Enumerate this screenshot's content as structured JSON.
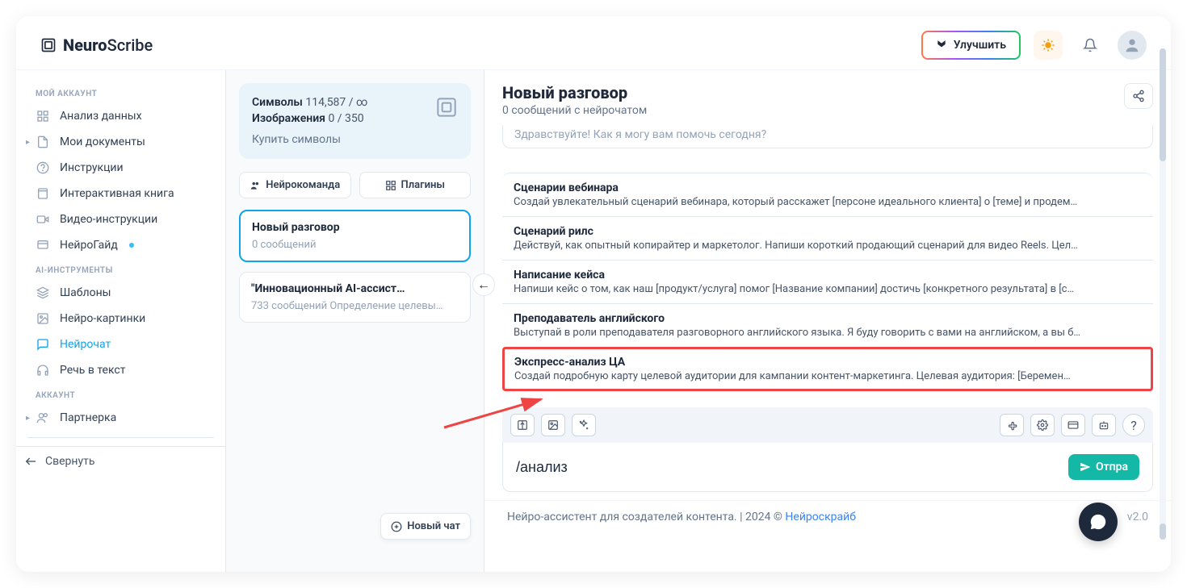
{
  "logo": {
    "bold": "Neuro",
    "regular": "Scribe"
  },
  "top": {
    "upgrade": "Улучшить"
  },
  "sidebar": {
    "sections": {
      "account": "МОЙ АККАУНТ",
      "tools": "AI-ИНСТРУМЕНТЫ",
      "acct": "АККАУНТ"
    },
    "items": [
      {
        "label": "Анализ данных"
      },
      {
        "label": "Мои документы"
      },
      {
        "label": "Инструкции"
      },
      {
        "label": "Интерактивная книга"
      },
      {
        "label": "Видео-инструкции"
      },
      {
        "label": "НейроГайд"
      }
    ],
    "tools": [
      {
        "label": "Шаблоны"
      },
      {
        "label": "Нейро-картинки"
      },
      {
        "label": "Нейрочат"
      },
      {
        "label": "Речь в текст"
      }
    ],
    "acct": [
      {
        "label": "Партнерка"
      }
    ],
    "collapse": "Свернуть"
  },
  "stats": {
    "symbols_label": "Символы",
    "symbols_value": "114,587 / ∞",
    "images_label": "Изображения",
    "images_value": "0 / 350",
    "buy": "Купить символы"
  },
  "midTabs": {
    "team": "Нейрокоманда",
    "plugins": "Плагины"
  },
  "conversations": [
    {
      "title": "Новый разговор",
      "sub": "0 сообщений",
      "active": true
    },
    {
      "title": "\"Инновационный AI-ассист…",
      "sub": "733 сообщений Определение целевы…"
    }
  ],
  "newChat": "Новый чат",
  "chat": {
    "title": "Новый разговор",
    "subtitle": "0 сообщений с нейрочатом",
    "greeting": "Здравствуйте! Как я могу вам помочь сегодня?"
  },
  "suggestions": [
    {
      "title": "Сценарии вебинара",
      "desc": "Создай увлекательный сценарий вебинара, который расскажет [персоне идеального клиента] о [теме] и продем…"
    },
    {
      "title": "Сценарий рилс",
      "desc": "Действуй, как опытный копирайтер и маркетолог. Напиши короткий продающий сценарий для видео Reels. Цел…"
    },
    {
      "title": "Написание кейса",
      "desc": "Напиши кейс о том, как наш [продукт/услуга] помог [Название компании] достичь [конкретного результата] в [с…"
    },
    {
      "title": "Преподаватель английского",
      "desc": "Выступай в роли преподавателя разговорного английского языка. Я буду говорить с вами на английском, а вы б…"
    },
    {
      "title": "Экспресс-анализ ЦА",
      "desc": "Создай подробную карту целевой аудитории для кампании контент-маркетинга. Целевая аудитория: [Беремен…",
      "highlighted": true
    }
  ],
  "input": {
    "value": "/анализ",
    "send": "Отпра"
  },
  "footer": {
    "text": "Нейро-ассистент для создателей контента.  | 2024 © ",
    "link": "Нейроскрайб",
    "version": "v2.0"
  }
}
